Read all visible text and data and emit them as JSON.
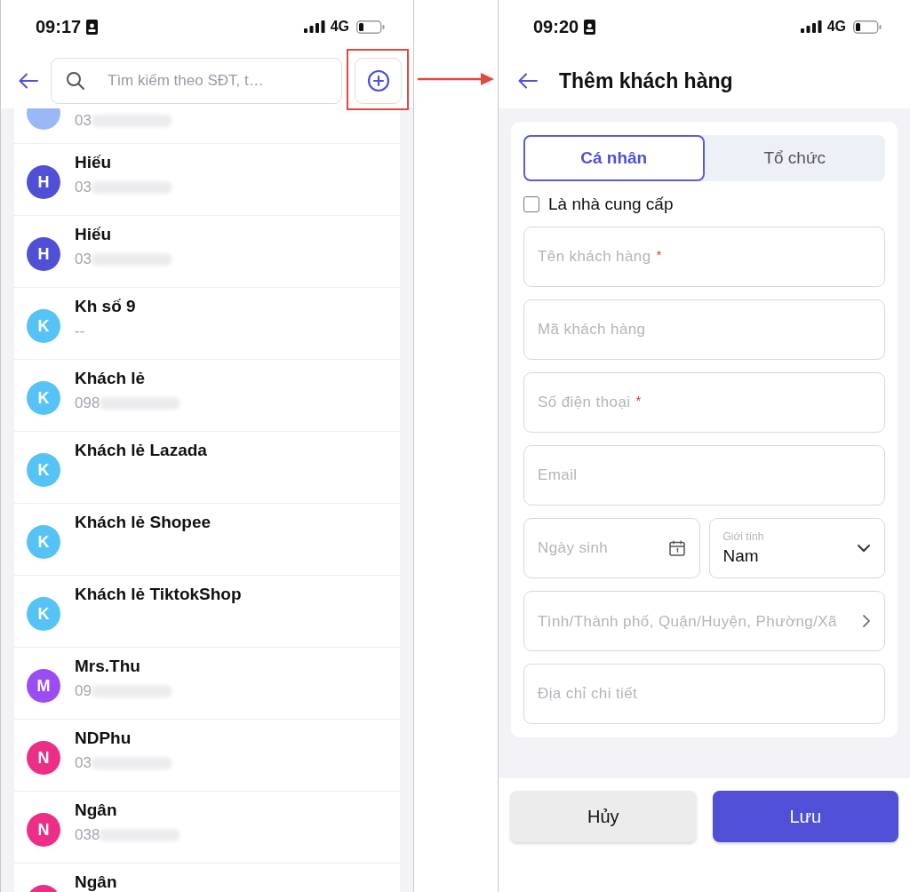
{
  "list_screen": {
    "status_bar": {
      "time": "09:17",
      "network": "4G"
    },
    "search": {
      "placeholder": "Tìm kiếm theo SĐT, t…"
    },
    "customers": [
      {
        "color": "#9bb8f6",
        "phone": "03",
        "redacted": true
      },
      {
        "initial": "H",
        "color": "#4f50d6",
        "name": "Hiếu",
        "phone": "03",
        "redacted": true
      },
      {
        "initial": "H",
        "color": "#4f50d6",
        "name": "Hiếu",
        "phone": "03",
        "redacted": true
      },
      {
        "initial": "K",
        "color": "#55c3f5",
        "name": "Kh số 9",
        "phone": "--",
        "redacted": false
      },
      {
        "initial": "K",
        "color": "#55c3f5",
        "name": "Khách lẻ",
        "phone": "098",
        "redacted": true
      },
      {
        "initial": "K",
        "color": "#55c3f5",
        "name": "Khách lẻ Lazada"
      },
      {
        "initial": "K",
        "color": "#55c3f5",
        "name": "Khách lẻ Shopee"
      },
      {
        "initial": "K",
        "color": "#55c3f5",
        "name": "Khách lẻ TiktokShop"
      },
      {
        "initial": "M",
        "color": "#9b4cf5",
        "name": "Mrs.Thu",
        "phone": "09",
        "redacted": true
      },
      {
        "initial": "N",
        "color": "#ec2e86",
        "name": "NDPhu",
        "phone": "03",
        "redacted": true
      },
      {
        "initial": "N",
        "color": "#ec2e86",
        "name": "Ngân",
        "phone": "038",
        "redacted": true
      },
      {
        "color": "#ec2e86",
        "name": "Ngân"
      }
    ]
  },
  "form_screen": {
    "status_bar": {
      "time": "09:20",
      "network": "4G"
    },
    "title": "Thêm khách hàng",
    "tabs": [
      {
        "label": "Cá nhân",
        "selected": true
      },
      {
        "label": "Tổ chức",
        "selected": false
      }
    ],
    "supplier_checkbox": {
      "label": "Là nhà cung cấp",
      "checked": false
    },
    "fields": [
      {
        "kind": "text",
        "placeholder": "Tên khách hàng",
        "required_mark": "*"
      },
      {
        "kind": "text",
        "placeholder": "Mã khách hàng"
      },
      {
        "kind": "text",
        "placeholder": "Số điện thoại",
        "required_mark": "*"
      },
      {
        "kind": "text",
        "placeholder": "Email"
      },
      {
        "kind": "date",
        "placeholder": "Ngày sinh"
      },
      {
        "kind": "select",
        "label": "Giới tính",
        "value": "Nam"
      },
      {
        "kind": "picker",
        "placeholder": "Tình/Thành phố, Quận/Huyện, Phường/Xã"
      },
      {
        "kind": "text",
        "placeholder": "Địa chỉ chi tiết"
      }
    ],
    "buttons": [
      {
        "label": "Hủy",
        "kind": "secondary"
      },
      {
        "label": "Lưu",
        "kind": "primary"
      }
    ]
  }
}
